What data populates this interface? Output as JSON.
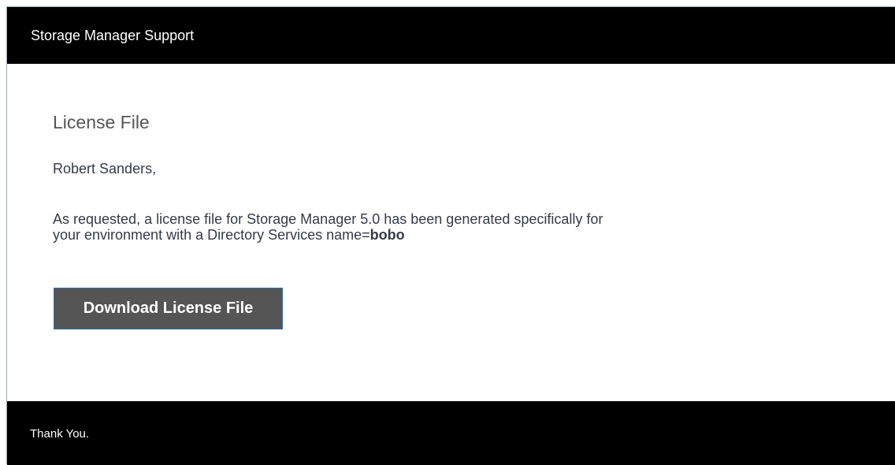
{
  "header": {
    "title": "Storage Manager Support"
  },
  "content": {
    "title": "License File",
    "greeting": "Robert Sanders,",
    "message_line1": "As requested, a license file for Storage Manager 5.0 has been generated specifically for",
    "message_line2": "your environment with a Directory Services name=",
    "directory_name": "bobo",
    "download_button_label": "Download License File"
  },
  "footer": {
    "text": "Thank You."
  },
  "colors": {
    "header_bg": "#000000",
    "footer_bg": "#000000",
    "button_bg": "#555555",
    "text": "#333b4a"
  }
}
